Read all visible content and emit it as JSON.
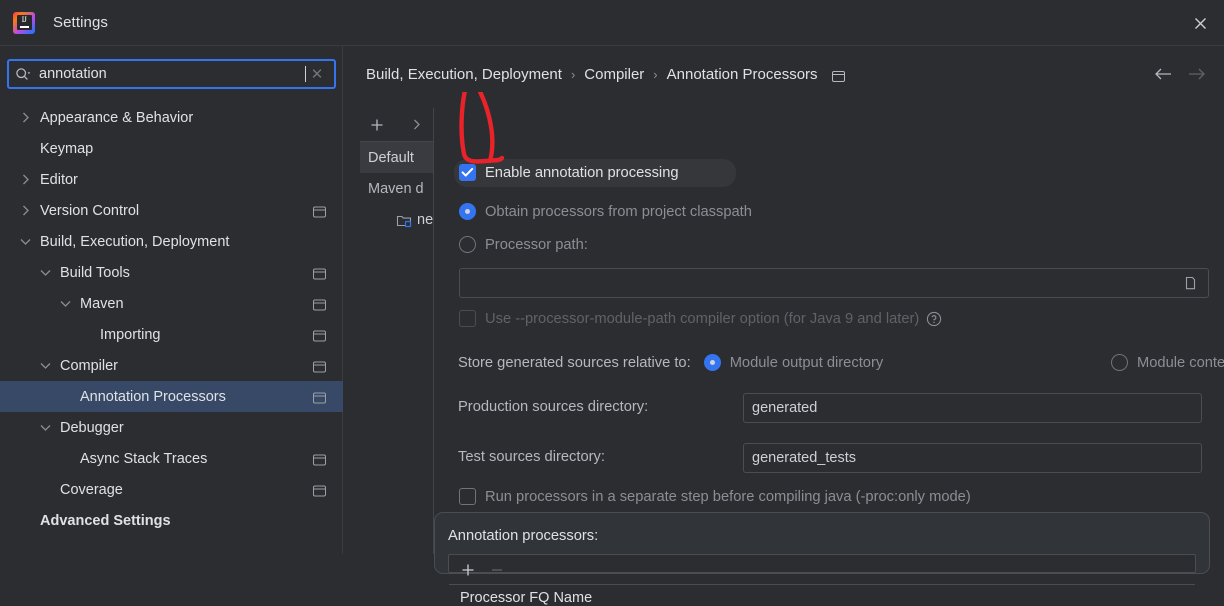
{
  "window": {
    "title": "Settings",
    "logo_icon": "intellij-idea-logo",
    "close_icon": "close-icon"
  },
  "search": {
    "value": "annotation",
    "placeholder": "",
    "search_icon": "search-icon",
    "clear_icon": "clear-icon",
    "clear_glyph": "✕"
  },
  "sidebar": {
    "items": [
      {
        "label": "Appearance & Behavior",
        "indent": 0,
        "twisty": "chevron-right",
        "badge": false,
        "selected": false,
        "bold": false
      },
      {
        "label": "Keymap",
        "indent": 0,
        "twisty": "none",
        "badge": false,
        "selected": false,
        "bold": false
      },
      {
        "label": "Editor",
        "indent": 0,
        "twisty": "chevron-right",
        "badge": false,
        "selected": false,
        "bold": false
      },
      {
        "label": "Version Control",
        "indent": 0,
        "twisty": "chevron-right",
        "badge": true,
        "selected": false,
        "bold": false
      },
      {
        "label": "Build, Execution, Deployment",
        "indent": 0,
        "twisty": "chevron-down",
        "badge": false,
        "selected": false,
        "bold": false
      },
      {
        "label": "Build Tools",
        "indent": 1,
        "twisty": "chevron-down",
        "badge": true,
        "selected": false,
        "bold": false
      },
      {
        "label": "Maven",
        "indent": 2,
        "twisty": "chevron-down",
        "badge": true,
        "selected": false,
        "bold": false
      },
      {
        "label": "Importing",
        "indent": 3,
        "twisty": "none",
        "badge": true,
        "selected": false,
        "bold": false
      },
      {
        "label": "Compiler",
        "indent": 1,
        "twisty": "chevron-down",
        "badge": true,
        "selected": false,
        "bold": false
      },
      {
        "label": "Annotation Processors",
        "indent": 2,
        "twisty": "none",
        "badge": true,
        "selected": true,
        "bold": false
      },
      {
        "label": "Debugger",
        "indent": 1,
        "twisty": "chevron-down",
        "badge": false,
        "selected": false,
        "bold": false
      },
      {
        "label": "Async Stack Traces",
        "indent": 2,
        "twisty": "none",
        "badge": true,
        "selected": false,
        "bold": false
      },
      {
        "label": "Coverage",
        "indent": 1,
        "twisty": "none",
        "badge": true,
        "selected": false,
        "bold": false
      },
      {
        "label": "Advanced Settings",
        "indent": 0,
        "twisty": "none",
        "badge": false,
        "selected": false,
        "bold": true
      }
    ]
  },
  "breadcrumb": {
    "crumb1": "Build, Execution, Deployment",
    "crumb2": "Compiler",
    "crumb3": "Annotation Processors",
    "separator": "›",
    "badge_icon": "project-settings-badge-icon",
    "back_icon": "arrow-left-icon",
    "forward_icon": "arrow-right-icon"
  },
  "module_panel": {
    "add_icon": "plus-icon",
    "expand_icon": "chevron-right-icon",
    "items": [
      {
        "label": "Default",
        "selected": true,
        "type": "profile"
      },
      {
        "label": "Maven d",
        "selected": false,
        "type": "profile"
      }
    ],
    "module": {
      "label": "ne",
      "icon": "module-folder-icon"
    }
  },
  "main": {
    "enable_annotation_processing": {
      "label": "Enable annotation processing",
      "checked": true,
      "highlighted": true
    },
    "source_mode": {
      "options": [
        {
          "label": "Obtain processors from project classpath",
          "selected": true
        },
        {
          "label": "Processor path:",
          "selected": false
        }
      ]
    },
    "processor_path": {
      "value": "",
      "browse_icon": "folder-browse-icon"
    },
    "processor_module_path": {
      "label": "Use --processor-module-path compiler option (for Java 9 and later)",
      "checked": false,
      "disabled": true,
      "help_icon": "help-circle-icon"
    },
    "store_generated": {
      "label": "Store generated sources relative to:",
      "options": [
        {
          "label": "Module output directory",
          "selected": true
        },
        {
          "label": "Module content root",
          "selected": false
        }
      ]
    },
    "production_sources": {
      "label": "Production sources directory:",
      "value": "generated"
    },
    "test_sources": {
      "label": "Test sources directory:",
      "value": "generated_tests"
    },
    "run_separate_step": {
      "label": "Run processors in a separate step before compiling java (-proc:only mode)",
      "checked": false
    },
    "annotation_processors_box": {
      "title": "Annotation processors:",
      "add_icon": "plus-icon",
      "remove_icon": "minus-icon",
      "column_header": "Processor FQ Name"
    }
  },
  "annotation": {
    "shape": "hand-drawn-red-bracket",
    "color": "#e8232a",
    "target": "enable-annotation-processing-checkbox"
  },
  "colors": {
    "accent": "#3574f0",
    "background": "#2b2d30",
    "selection": "#374966",
    "border": "#4a4d52",
    "text": "#dfe1e5",
    "text_dim": "#8b8f95"
  }
}
